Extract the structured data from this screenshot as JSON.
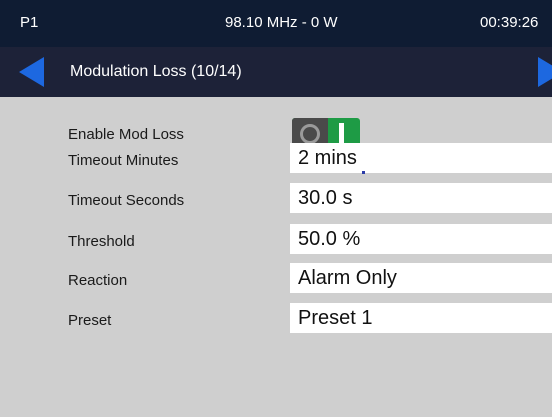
{
  "status_bar": {
    "preset": "P1",
    "frequency_power": "98.10 MHz - 0 W",
    "time": "00:39:26"
  },
  "nav": {
    "title": "Modulation Loss (10/14)"
  },
  "settings": {
    "enable_mod_loss": {
      "label": "Enable Mod Loss",
      "state": "on"
    },
    "timeout_minutes": {
      "label": "Timeout Minutes",
      "value": "2 mins"
    },
    "timeout_seconds": {
      "label": "Timeout Seconds",
      "value": "30.0 s"
    },
    "threshold": {
      "label": "Threshold",
      "value": "50.0 %"
    },
    "reaction": {
      "label": "Reaction",
      "value": "Alarm Only"
    },
    "preset": {
      "label": "Preset",
      "value": "Preset 1"
    }
  },
  "colors": {
    "status_bg": "#0f1c33",
    "nav_bg": "#1d2238",
    "arrow": "#1d68e0",
    "body_bg": "#cfcfcf",
    "toggle_on": "#1e9b45"
  }
}
